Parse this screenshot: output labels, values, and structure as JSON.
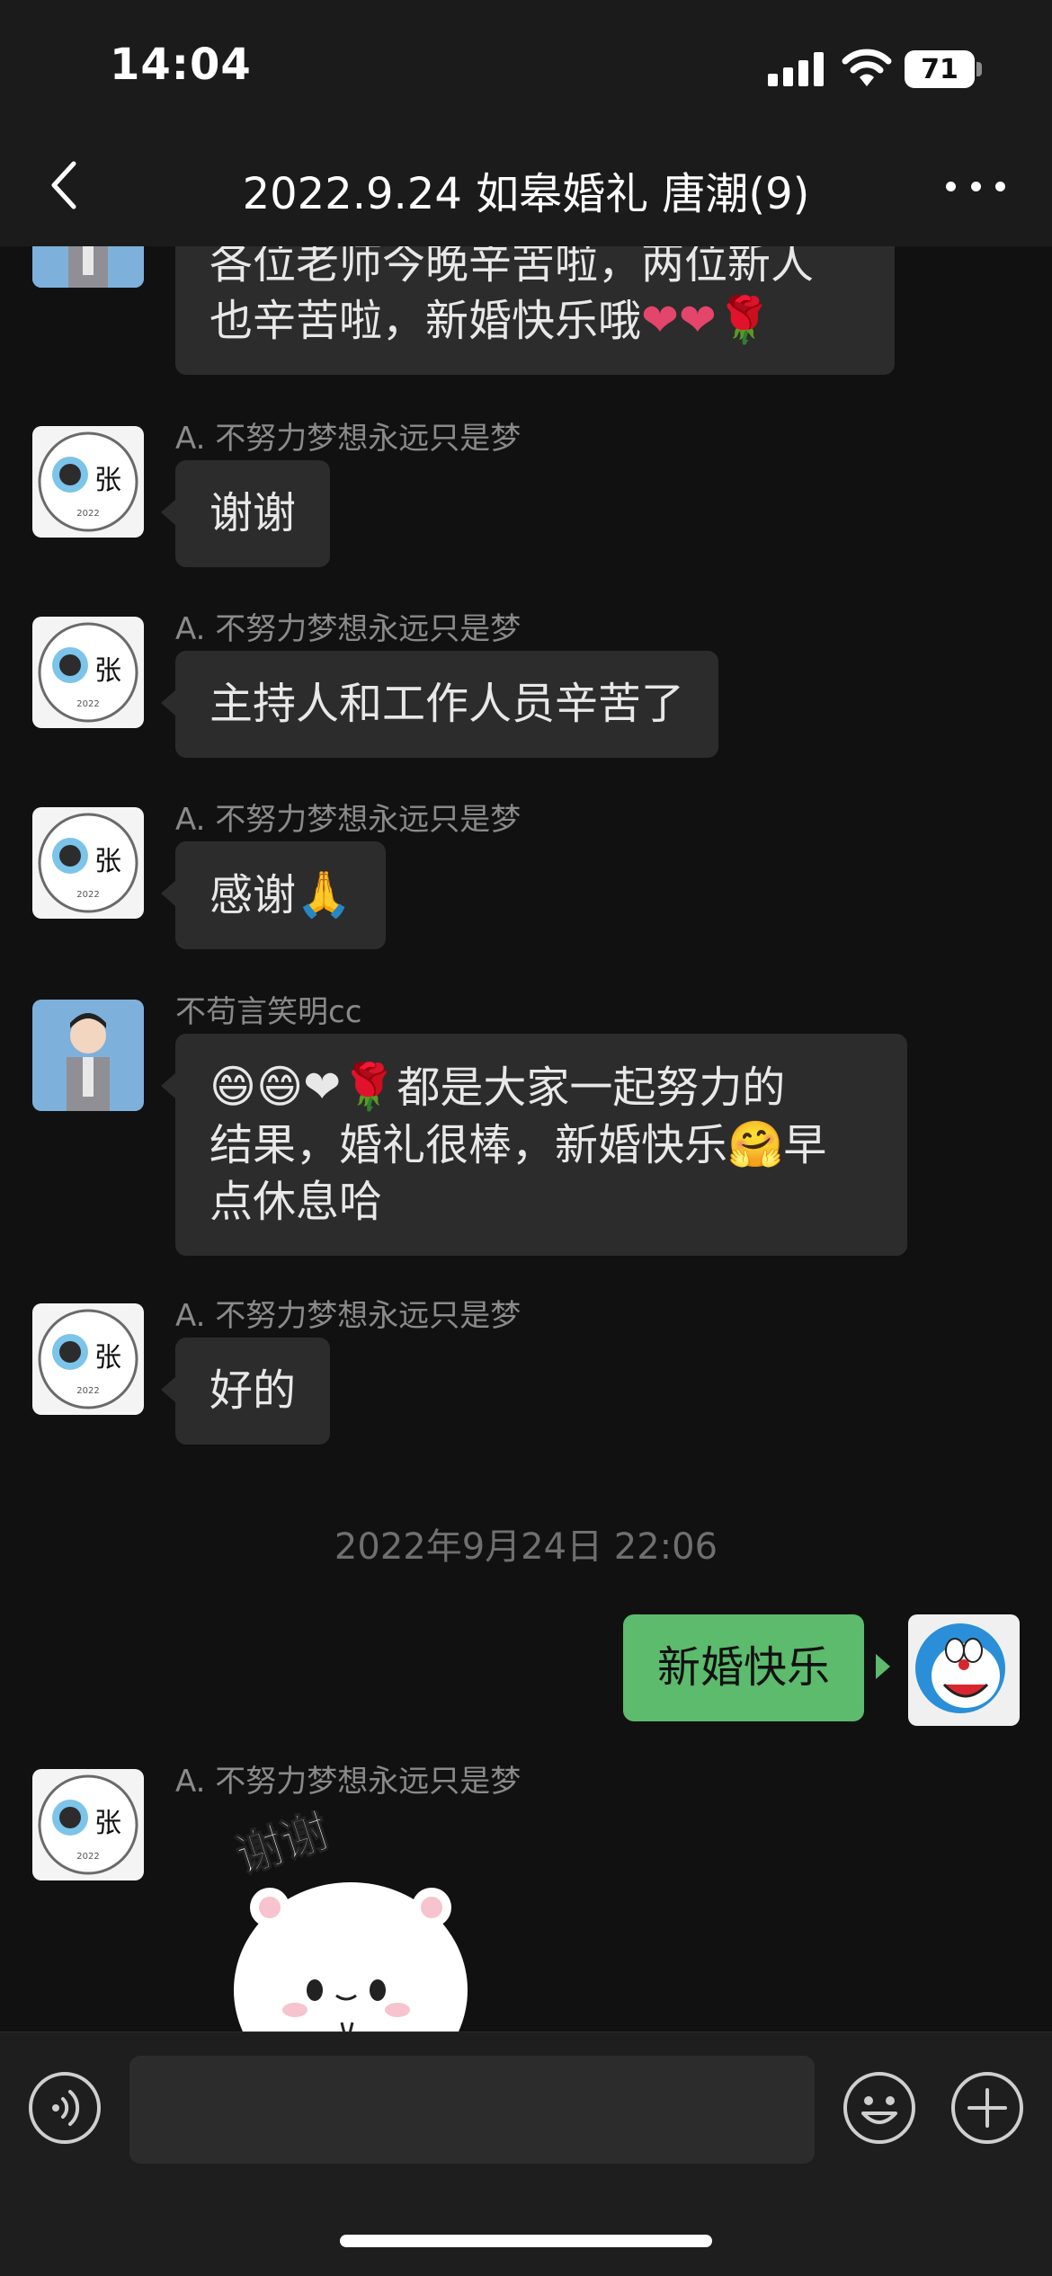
{
  "status_bar": {
    "time": "14:04",
    "battery": "71"
  },
  "nav": {
    "title": "2022.9.24 如皋婚礼 唐潮(9)"
  },
  "messages": [
    {
      "sender": "",
      "lines": [
        "各位老师今晚辛苦啦，两位新人",
        "也辛苦啦，新婚快乐哦"
      ],
      "emojis": "❤❤🌹"
    },
    {
      "sender": "A. 不努力梦想永远只是梦",
      "text": "谢谢"
    },
    {
      "sender": "A. 不努力梦想永远只是梦",
      "text": "主持人和工作人员辛苦了"
    },
    {
      "sender": "A. 不努力梦想永远只是梦",
      "text": "感谢",
      "emoji": "🙏"
    },
    {
      "sender": "不苟言笑明cc",
      "lead_emojis": "😄😄❤🌹",
      "lines": [
        "都是大家一起努力的",
        "结果，婚礼很棒，新婚快乐",
        "早",
        "点休息哈"
      ],
      "hug_emoji": "🤗"
    },
    {
      "sender": "A. 不努力梦想永远只是梦",
      "text": "好的"
    },
    {
      "timestamp": "2022年9月24日 22:06"
    },
    {
      "sender": "",
      "text": "新婚快乐",
      "outgoing": true
    },
    {
      "sender": "A. 不努力梦想永远只是梦",
      "sticker_text": "谢谢"
    }
  ],
  "avatar_text": {
    "zhang": "张",
    "year": "2022"
  },
  "input": {
    "placeholder": ""
  },
  "colors": {
    "background": "#111111",
    "bubble_in": "#2c2c2c",
    "bubble_out": "#5cbb6c",
    "bar": "#1b1b1b"
  },
  "icons": [
    "back-arrow-icon",
    "more-dots-icon",
    "signal-icon",
    "wifi-icon",
    "battery-icon",
    "voice-icon",
    "emoji-icon",
    "plus-icon"
  ]
}
